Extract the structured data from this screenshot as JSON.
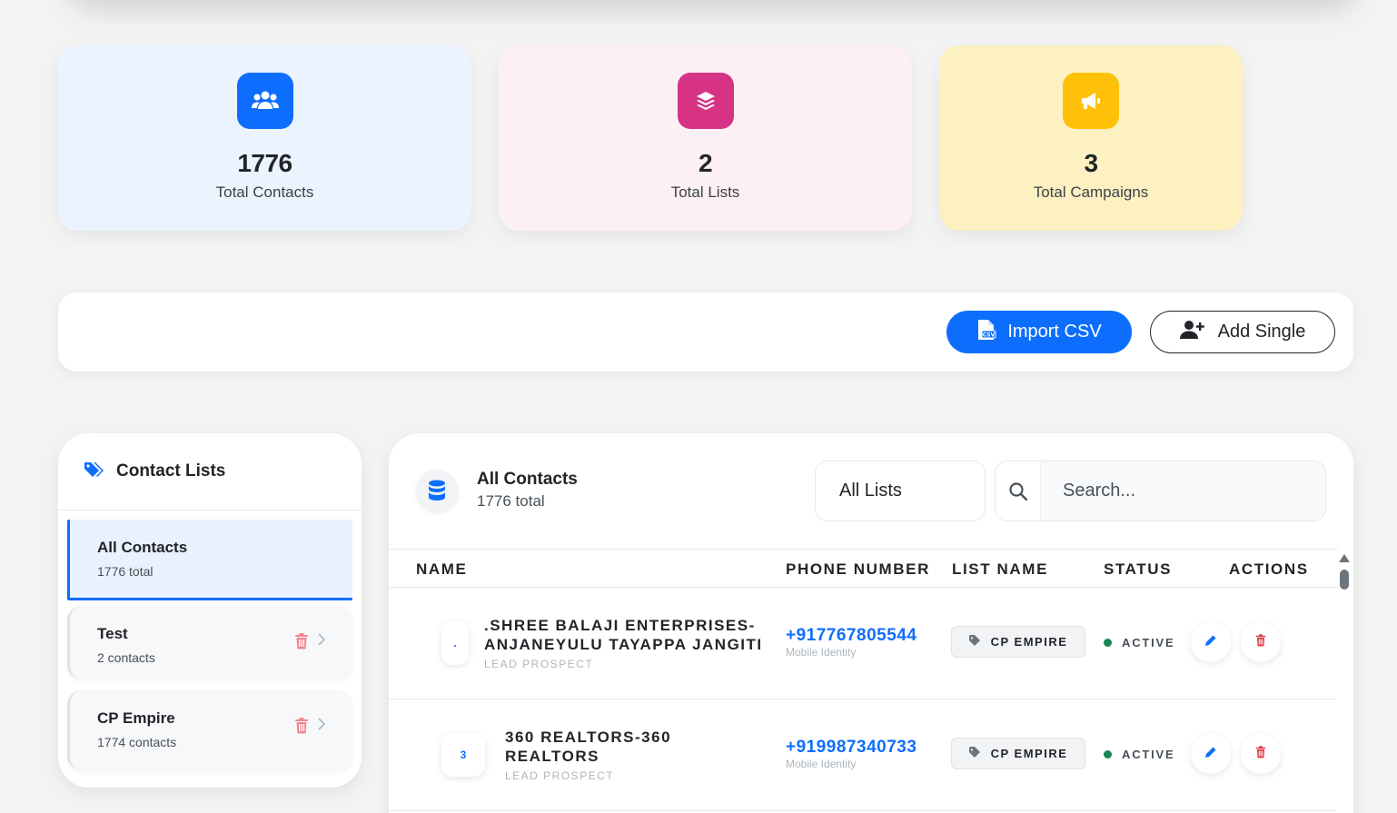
{
  "stats": [
    {
      "value": "1776",
      "label": "Total Contacts",
      "icon": "users-icon",
      "bg": "#eaf3fe",
      "icon_bg": "#0d6efd"
    },
    {
      "value": "2",
      "label": "Total Lists",
      "icon": "layers-icon",
      "bg": "#fcf0f5",
      "icon_bg": "#d63384"
    },
    {
      "value": "3",
      "label": "Total Campaigns",
      "icon": "megaphone-icon",
      "bg": "#fdf1c2",
      "icon_bg": "#ffc107"
    }
  ],
  "toolbar": {
    "import_label": "Import CSV",
    "add_label": "Add Single"
  },
  "sidebar": {
    "title": "Contact Lists",
    "items": [
      {
        "name": "All Contacts",
        "count": "1776 total"
      },
      {
        "name": "Test",
        "count": "2 contacts"
      },
      {
        "name": "CP Empire",
        "count": "1774 contacts"
      }
    ]
  },
  "contacts": {
    "title": "All Contacts",
    "subtitle": "1776 total",
    "filter_value": "All Lists",
    "search_placeholder": "Search...",
    "columns": [
      "NAME",
      "PHONE NUMBER",
      "LIST NAME",
      "STATUS",
      "ACTIONS"
    ],
    "rows": [
      {
        "avatar": ".",
        "name": ".SHREE BALAJI ENTERPRISES-ANJANEYULU TAYAPPA JANGITI",
        "name_lines": [
          ".SHREE BALAJI ENTERPRISES-",
          "ANJANEYULU TAYAPPA JANGITI"
        ],
        "type": "LEAD PROSPECT",
        "phone": "+917767805544",
        "phone_label": "Mobile Identity",
        "list": "CP EMPIRE",
        "status": "ACTIVE"
      },
      {
        "avatar": "3",
        "name": "360 REALTORS-360 REALTORS",
        "name_lines": [
          "360 REALTORS-360",
          "REALTORS"
        ],
        "type": "LEAD PROSPECT",
        "phone": "+919987340733",
        "phone_label": "Mobile Identity",
        "list": "CP EMPIRE",
        "status": "ACTIVE"
      }
    ]
  }
}
